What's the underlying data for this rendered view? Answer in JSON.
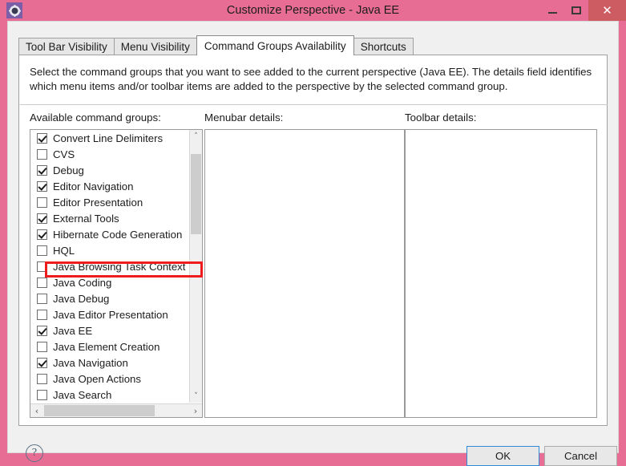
{
  "window": {
    "title": "Customize Perspective - Java EE",
    "icon": "gear-icon",
    "accent_pink": "#e86d95",
    "close_red": "#cc5b62",
    "controls": {
      "minimize": "–",
      "maximize": "□",
      "close": "✕"
    }
  },
  "tabs": [
    {
      "label": "Tool Bar Visibility",
      "active": false
    },
    {
      "label": "Menu Visibility",
      "active": false
    },
    {
      "label": "Command Groups Availability",
      "active": true
    },
    {
      "label": "Shortcuts",
      "active": false
    }
  ],
  "description": "Select the command groups that you want to see added to the current perspective (Java EE).  The details field identifies which menu items and/or toolbar items are added to the perspective by the selected command group.",
  "columns": {
    "available": "Available command groups:",
    "menubar": "Menubar details:",
    "toolbar": "Toolbar details:"
  },
  "command_groups": [
    {
      "label": "Convert Line Delimiters",
      "checked": true,
      "highlighted": false
    },
    {
      "label": "CVS",
      "checked": false,
      "highlighted": false
    },
    {
      "label": "Debug",
      "checked": true,
      "highlighted": false
    },
    {
      "label": "Editor Navigation",
      "checked": true,
      "highlighted": false
    },
    {
      "label": "Editor Presentation",
      "checked": false,
      "highlighted": false
    },
    {
      "label": "External Tools",
      "checked": true,
      "highlighted": false
    },
    {
      "label": "Hibernate Code Generation",
      "checked": true,
      "highlighted": true
    },
    {
      "label": "HQL",
      "checked": false,
      "highlighted": false
    },
    {
      "label": "Java Browsing Task Context",
      "checked": false,
      "highlighted": false
    },
    {
      "label": "Java Coding",
      "checked": false,
      "highlighted": false
    },
    {
      "label": "Java Debug",
      "checked": false,
      "highlighted": false
    },
    {
      "label": "Java Editor Presentation",
      "checked": false,
      "highlighted": false
    },
    {
      "label": "Java EE",
      "checked": true,
      "highlighted": false
    },
    {
      "label": "Java Element Creation",
      "checked": false,
      "highlighted": false
    },
    {
      "label": "Java Navigation",
      "checked": true,
      "highlighted": false
    },
    {
      "label": "Java Open Actions",
      "checked": false,
      "highlighted": false
    },
    {
      "label": "Java Search",
      "checked": false,
      "highlighted": false
    }
  ],
  "menubar_details": [],
  "toolbar_details": [],
  "scrollbars": {
    "vertical": {
      "up_arrow": "˄",
      "down_arrow": "˅"
    },
    "horizontal": {
      "left_arrow": "‹",
      "right_arrow": "›"
    }
  },
  "footer": {
    "help": "?",
    "ok_label": "OK",
    "cancel_label": "Cancel",
    "focus_color": "#2f8ad8"
  },
  "annotation": {
    "color": "#ee1c1c",
    "target": "Hibernate Code Generation"
  }
}
